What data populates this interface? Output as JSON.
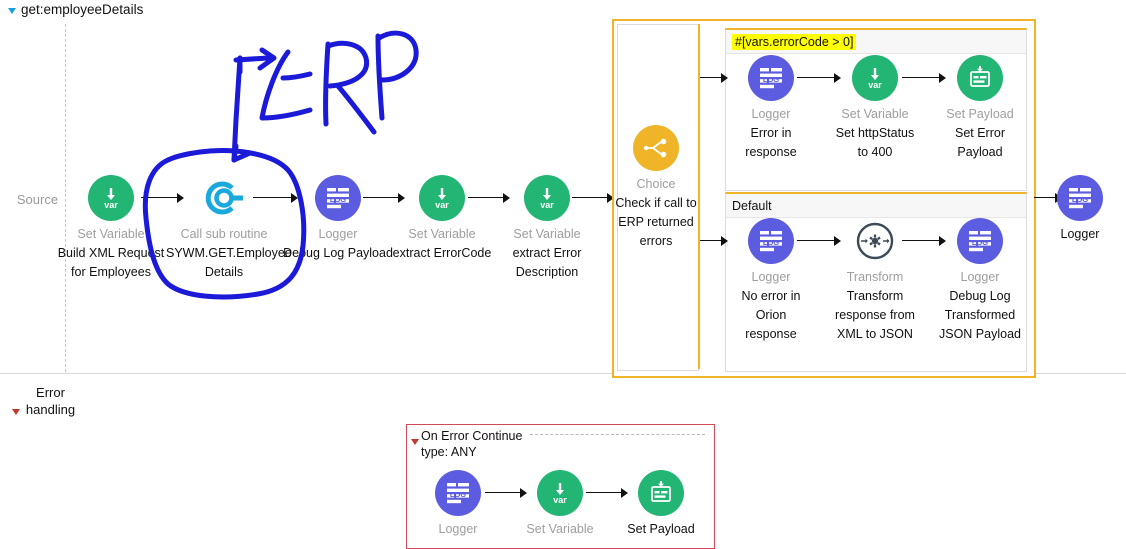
{
  "flow": {
    "title": "get:employeeDetails"
  },
  "lanes": {
    "source_label": "Source",
    "error_label_line1": "Error",
    "error_label_line2": "handling"
  },
  "main_nodes": [
    {
      "type": "Set Variable",
      "desc": "Build XML Request for Employees",
      "icon": "set-variable-icon",
      "color": "#22b573"
    },
    {
      "type": "Call sub routine",
      "desc": "SYWM.GET.Employee Details",
      "icon": "flow-reference-icon",
      "color": "#1aa9dd"
    },
    {
      "type": "Logger",
      "desc": "Debug Log Payload",
      "icon": "logger-icon",
      "color": "#5c5ce0"
    },
    {
      "type": "Set Variable",
      "desc": "extract ErrorCode",
      "icon": "set-variable-icon",
      "color": "#22b573"
    },
    {
      "type": "Set Variable",
      "desc": "extract Error Description",
      "icon": "set-variable-icon",
      "color": "#22b573"
    }
  ],
  "choice": {
    "type": "Choice",
    "desc": "Check if call to ERP returned errors",
    "icon": "choice-icon",
    "color": "#f0b429",
    "branches": [
      {
        "condition": "#[vars.errorCode > 0]",
        "highlighted": true,
        "nodes": [
          {
            "type": "Logger",
            "desc": "Error in response",
            "icon": "logger-icon",
            "color": "#5c5ce0"
          },
          {
            "type": "Set Variable",
            "desc": "Set httpStatus to 400",
            "icon": "set-variable-icon",
            "color": "#22b573"
          },
          {
            "type": "Set Payload",
            "desc": "Set Error Payload",
            "icon": "set-payload-icon",
            "color": "#22b573"
          }
        ]
      },
      {
        "condition": "Default",
        "highlighted": false,
        "nodes": [
          {
            "type": "Logger",
            "desc": "No error in Orion response",
            "icon": "logger-icon",
            "color": "#5c5ce0"
          },
          {
            "type": "Transform",
            "desc": "Transform response from XML to JSON",
            "icon": "transform-icon",
            "color": "#3b4a56"
          },
          {
            "type": "Logger",
            "desc": "Debug Log Transformed JSON Payload",
            "icon": "logger-icon",
            "color": "#5c5ce0"
          }
        ]
      }
    ]
  },
  "tail_node": {
    "type": "Logger",
    "desc": "",
    "icon": "logger-icon",
    "color": "#5c5ce0"
  },
  "error_handling": {
    "header_line1": "On Error Continue",
    "header_line2": "type: ANY",
    "nodes": [
      {
        "type": "Logger",
        "desc": "",
        "icon": "logger-icon",
        "color": "#5c5ce0",
        "type_dark": false
      },
      {
        "type": "Set Variable",
        "desc": "",
        "icon": "set-variable-icon",
        "color": "#22b573",
        "type_dark": false
      },
      {
        "type": "Set Payload",
        "desc": "",
        "icon": "set-payload-icon",
        "color": "#22b573",
        "type_dark": true
      }
    ]
  },
  "annotation": {
    "text": "ERP",
    "color": "#1a1ad8",
    "kind": "handwritten-ink",
    "note": "arrow from ERP pointing into circled Call sub routine node"
  },
  "theme": {
    "green": "#22b573",
    "blue": "#5c5ce0",
    "cyan": "#1aa9dd",
    "amber": "#f0b429",
    "slate": "#3b4a56",
    "error_red": "#d24a5a",
    "highlight_yellow": "#ffff00",
    "muted_text": "#9e9e9e"
  }
}
